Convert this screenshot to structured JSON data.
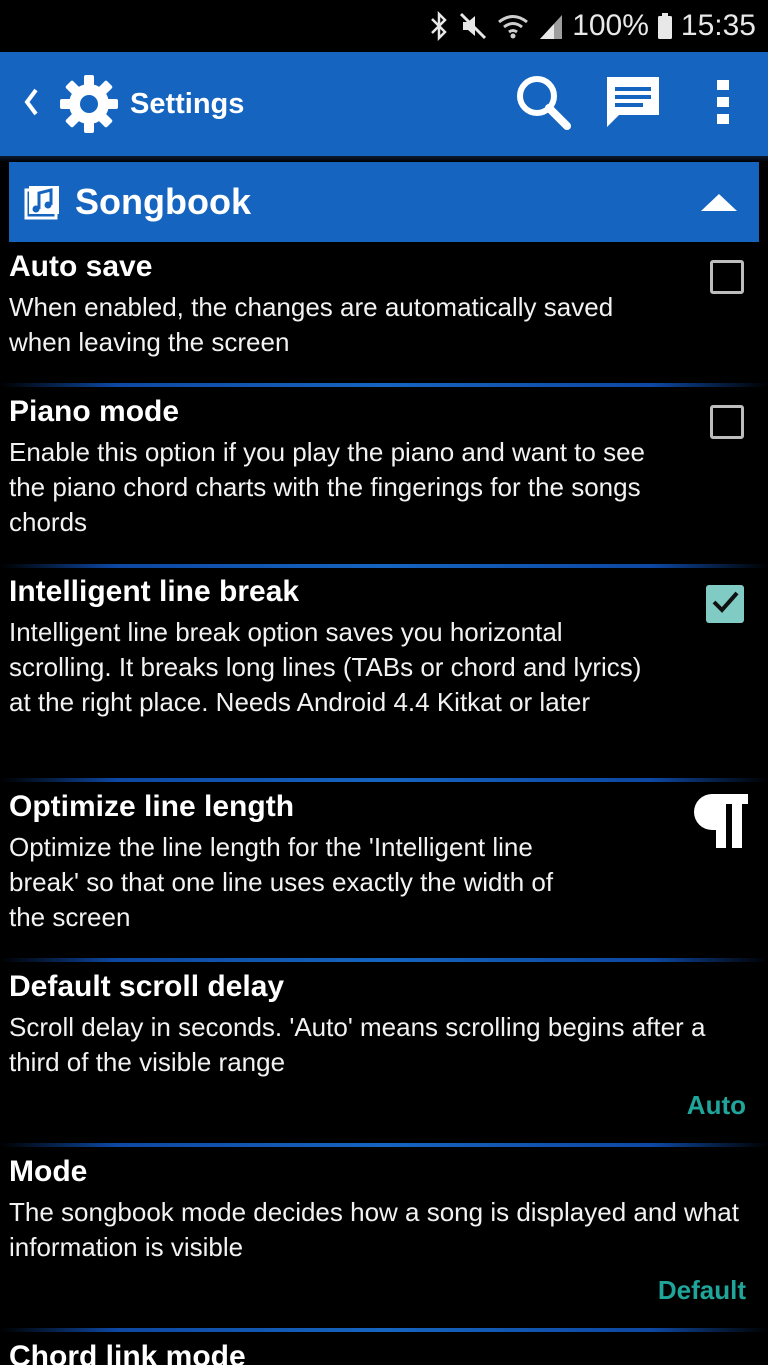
{
  "status_bar": {
    "battery_percent": "100%",
    "time": "15:35",
    "icons": [
      "bluetooth-icon",
      "mute-icon",
      "wifi-icon",
      "signal-icon",
      "battery-icon"
    ]
  },
  "toolbar": {
    "title": "Settings",
    "icons": [
      "back-icon",
      "gear-icon",
      "search-icon",
      "chat-icon",
      "more-icon"
    ]
  },
  "section": {
    "title": "Songbook",
    "icon": "songbook-icon",
    "expanded": true
  },
  "preferences": [
    {
      "title": "Auto save",
      "summary": "When enabled, the changes are automatically saved when leaving the screen",
      "widget": "checkbox",
      "checked": false
    },
    {
      "title": "Piano mode",
      "summary": "Enable this option if you play the piano and want to see the piano chord charts with the fingerings for the songs chords",
      "widget": "checkbox",
      "checked": false
    },
    {
      "title": "Intelligent line break",
      "summary": "Intelligent line break option saves you horizontal scrolling. It breaks long lines (TABs or chord and lyrics) at the right place. Needs Android 4.4 Kitkat or later",
      "widget": "checkbox",
      "checked": true
    },
    {
      "title": "Optimize line length",
      "summary": "Optimize the line length for the 'Intelligent line break' so that one line uses exactly the width of the screen",
      "widget": "icon",
      "icon": "pilcrow-icon"
    },
    {
      "title": "Default scroll delay",
      "summary": "Scroll delay in seconds. 'Auto' means scrolling begins after a third of the visible range",
      "value": "Auto"
    },
    {
      "title": "Mode",
      "summary": "The songbook mode decides how a song is displayed and what information is visible",
      "value": "Default"
    },
    {
      "title": "Chord link mode"
    }
  ],
  "colors": {
    "accent_blue": "#1565c0",
    "value_teal": "#1fa59a",
    "checkbox_checked": "#80cbc4"
  }
}
